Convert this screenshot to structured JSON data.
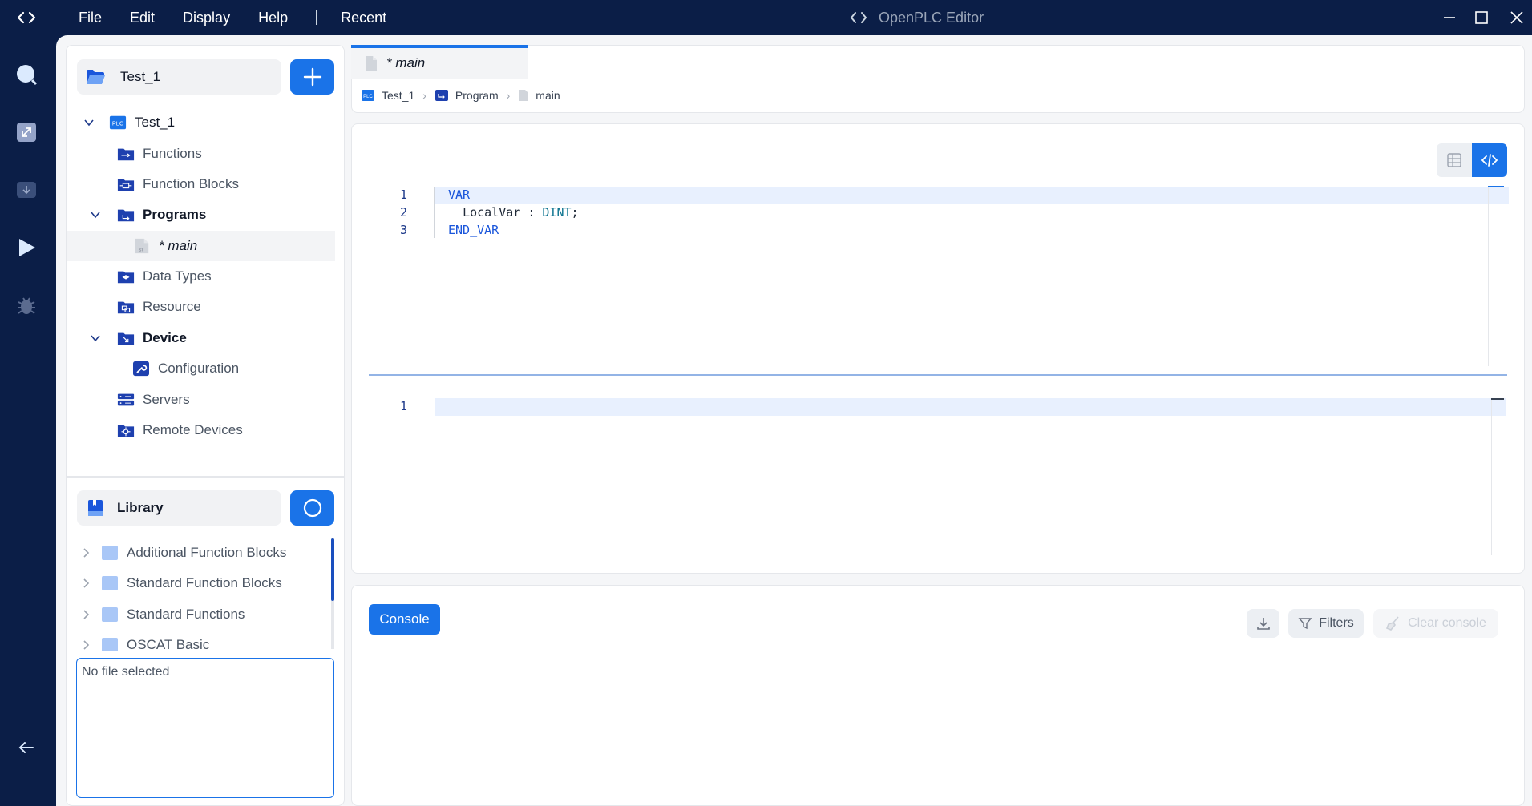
{
  "titlebar": {
    "menu": [
      "File",
      "Edit",
      "Display",
      "Help",
      "Recent"
    ],
    "app_title": "OpenPLC Editor"
  },
  "project": {
    "name": "Test_1",
    "tree": [
      {
        "label": "Test_1",
        "badge": "PLC"
      },
      {
        "label": "Functions"
      },
      {
        "label": "Function Blocks"
      },
      {
        "label": "Programs"
      },
      {
        "label": "* main"
      },
      {
        "label": "Data Types"
      },
      {
        "label": "Resource"
      },
      {
        "label": "Device"
      },
      {
        "label": "Configuration"
      },
      {
        "label": "Servers"
      },
      {
        "label": "Remote Devices"
      }
    ]
  },
  "library": {
    "title": "Library",
    "items": [
      "Additional Function Blocks",
      "Standard Function Blocks",
      "Standard Functions",
      "OSCAT Basic"
    ],
    "file_info": "No file selected"
  },
  "editor": {
    "tab_label": "* main",
    "breadcrumb": [
      "Test_1",
      "Program",
      "main"
    ],
    "variables_code": [
      {
        "n": "1",
        "text": "VAR"
      },
      {
        "n": "2",
        "text": "  LocalVar : DINT;"
      },
      {
        "n": "3",
        "text": "END_VAR"
      }
    ],
    "body_line_numbers": [
      "1"
    ]
  },
  "console": {
    "tab_label": "Console",
    "filters_label": "Filters",
    "clear_label": "Clear console"
  },
  "colors": {
    "navy": "#0b1e47",
    "accent": "#1a73e8"
  }
}
